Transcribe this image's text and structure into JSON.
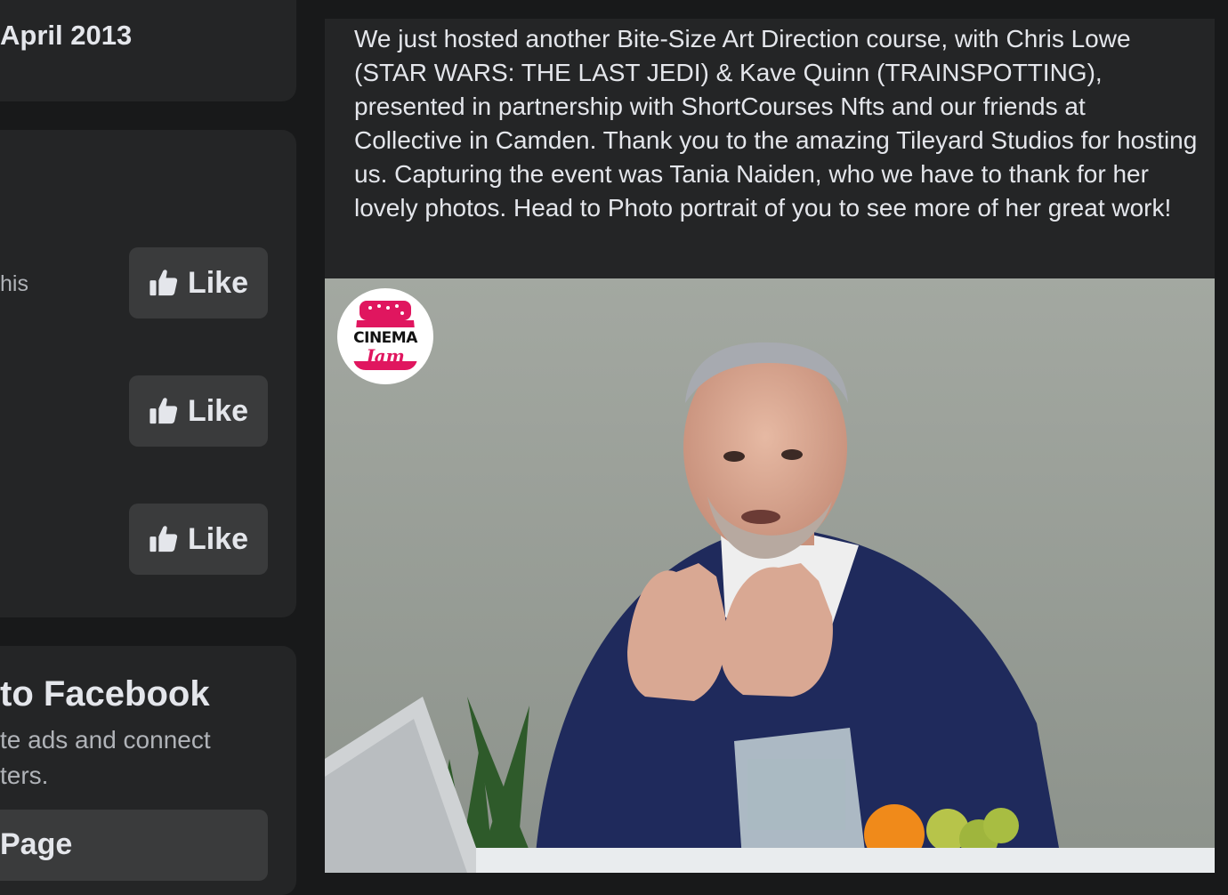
{
  "left_column": {
    "about": {
      "date_fragment": "April 2013"
    },
    "pages": {
      "text_fragment": "his",
      "like_buttons": [
        {
          "label": "Like"
        },
        {
          "label": "Like"
        },
        {
          "label": "Like"
        }
      ]
    },
    "signup": {
      "title_fragment": "to Facebook",
      "desc_line1": "te ads and connect",
      "desc_line2": "ters.",
      "button_fragment": "Page"
    }
  },
  "post": {
    "text": "We just hosted another Bite-Size Art Direction course, with Chris Lowe (STAR WARS: THE LAST JEDI) & Kave Quinn (TRAINSPOTTING), presented in partnership with ShortCourses Nfts and our friends at Collective in Camden. Thank you to the amazing Tileyard Studios for hosting us. Capturing the event was Tania Naiden, who we have to thank for her lovely photos. Head to Photo portrait of you to see more of her great work!",
    "photo": {
      "logo_line1": "CINEMA",
      "logo_line2": "Jam"
    }
  },
  "colors": {
    "page_bg": "#18191a",
    "card_bg": "#242526",
    "button_bg": "#3a3b3c",
    "text_primary": "#e4e6eb",
    "text_secondary": "#b0b3b8",
    "logo_accent": "#e0165f"
  },
  "icons": [
    "thumbs-up-icon"
  ]
}
